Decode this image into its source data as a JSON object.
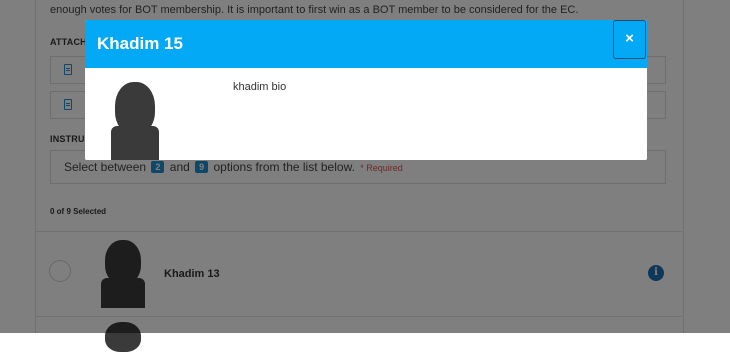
{
  "page": {
    "intro_text": "enough votes for BOT membership. It is important to first win as a BOT member to be considered for the EC.",
    "attachments_label": "ATTACHMENTS",
    "instructions_label": "INSTRUCTIONS",
    "instructions": {
      "prefix": "Select between",
      "min": "2",
      "middle": "and",
      "max": "9",
      "suffix": "options from the list below.",
      "required": "* Required"
    },
    "selected_count": "0 of 9 Selected",
    "candidates": [
      {
        "name": "Khadim 13",
        "info_icon": "info-icon",
        "avatar": "person-silhouette"
      }
    ]
  },
  "modal": {
    "title": "Khadim 15",
    "close_label": "×",
    "bio": "khadim bio",
    "avatar": "person-silhouette"
  },
  "colors": {
    "header": "#03a9f4",
    "badge": "#1f8fd3",
    "info": "#1f6fb5",
    "required": "#d9534f"
  }
}
